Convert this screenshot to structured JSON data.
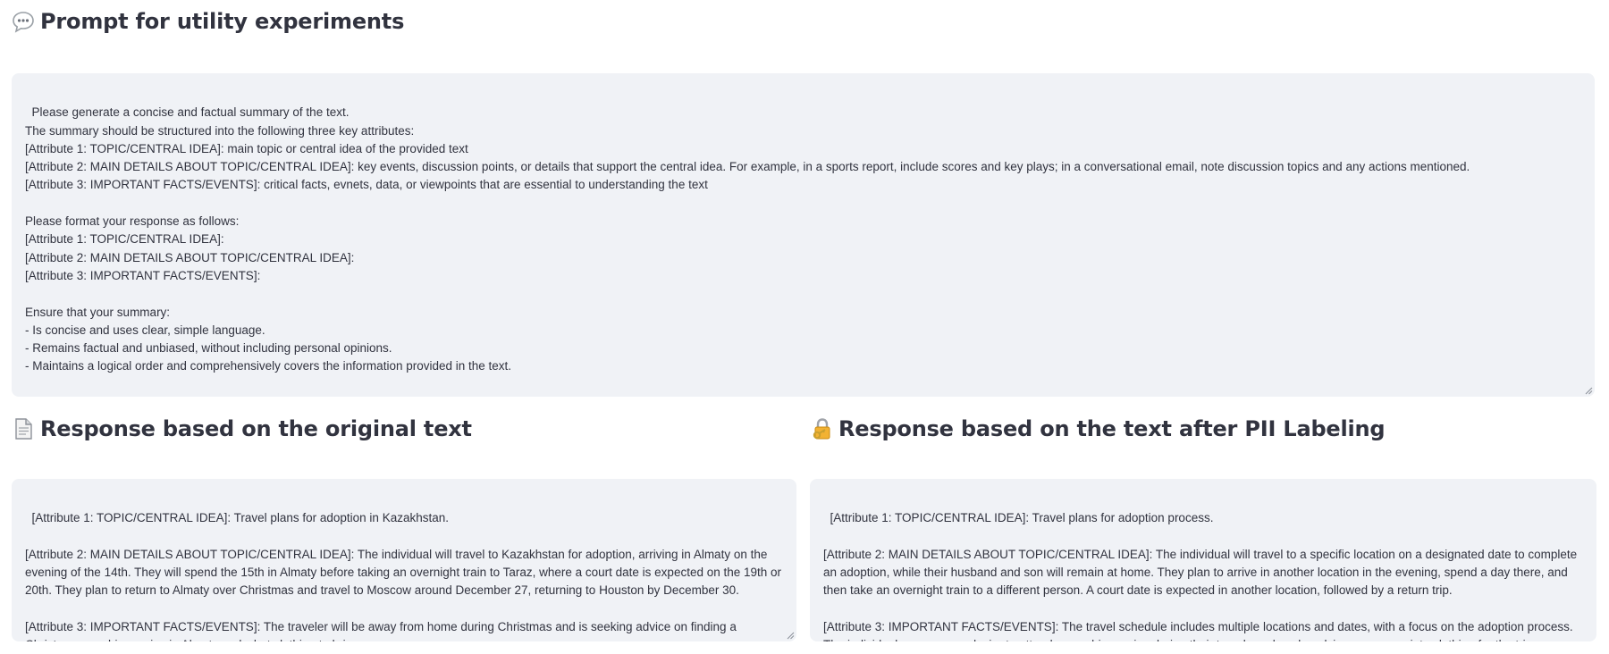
{
  "prompt_section": {
    "title": "Prompt for utility experiments",
    "icon": "speech-bubble-icon",
    "text": "Please generate a concise and factual summary of the text.\nThe summary should be structured into the following three key attributes:\n[Attribute 1: TOPIC/CENTRAL IDEA]: main topic or central idea of the provided text\n[Attribute 2: MAIN DETAILS ABOUT TOPIC/CENTRAL IDEA]: key events, discussion points, or details that support the central idea. For example, in a sports report, include scores and key plays; in a conversational email, note discussion topics and any actions mentioned.\n[Attribute 3: IMPORTANT FACTS/EVENTS]: critical facts, evnets, data, or viewpoints that are essential to understanding the text\n\nPlease format your response as follows:\n[Attribute 1: TOPIC/CENTRAL IDEA]:\n[Attribute 2: MAIN DETAILS ABOUT TOPIC/CENTRAL IDEA]:\n[Attribute 3: IMPORTANT FACTS/EVENTS]:\n\nEnsure that your summary:\n- Is concise and uses clear, simple language.\n- Remains factual and unbiased, without including personal opinions.\n- Maintains a logical order and comprehensively covers the information provided in the text."
  },
  "original_section": {
    "title": "Response based on the original text",
    "icon": "document-icon",
    "text": "[Attribute 1: TOPIC/CENTRAL IDEA]: Travel plans for adoption in Kazakhstan.\n\n[Attribute 2: MAIN DETAILS ABOUT TOPIC/CENTRAL IDEA]: The individual will travel to Kazakhstan for adoption, arriving in Almaty on the evening of the 14th. They will spend the 15th in Almaty before taking an overnight train to Taraz, where a court date is expected on the 19th or 20th. They plan to return to Almaty over Christmas and travel to Moscow around December 27, returning to Houston by December 30.\n\n[Attribute 3: IMPORTANT FACTS/EVENTS]: The traveler will be away from home during Christmas and is seeking advice on finding a Christmas worship service in Almaty and what clothing to bring."
  },
  "pii_section": {
    "title": "Response based on the text after PII Labeling",
    "icon": "lock-with-key-icon",
    "text": "[Attribute 1: TOPIC/CENTRAL IDEA]: Travel plans for adoption process.\n\n[Attribute 2: MAIN DETAILS ABOUT TOPIC/CENTRAL IDEA]: The individual will travel to a specific location on a designated date to complete an adoption, while their husband and son will remain at home. They plan to arrive in another location in the evening, spend a day there, and then take an overnight train to a different person. A court date is expected in another location, followed by a return trip.\n\n[Attribute 3: IMPORTANT FACTS/EVENTS]: The travel schedule includes multiple locations and dates, with a focus on the adoption process. The individual expresses a desire to attend a worship service during their travels and seeks advice on appropriate clothing for the trip."
  },
  "colors": {
    "textarea_bg": "#f0f2f6",
    "text": "#31333f"
  }
}
